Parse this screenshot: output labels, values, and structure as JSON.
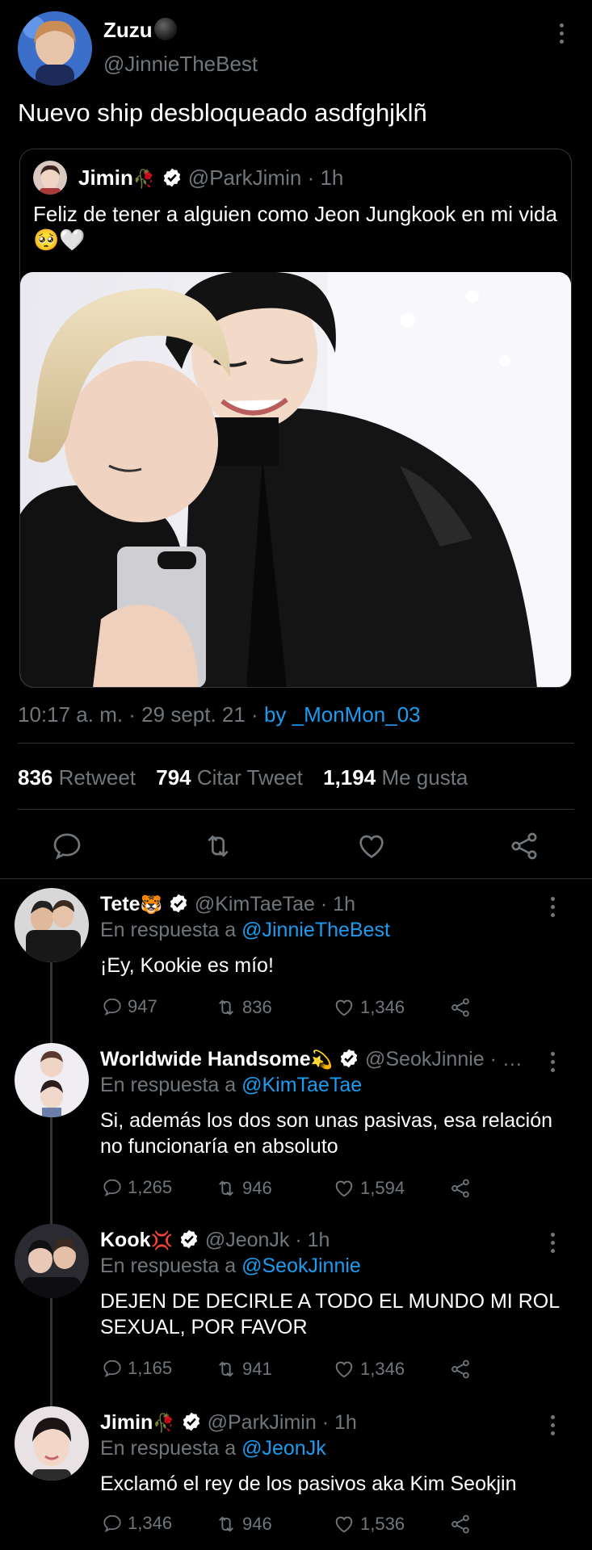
{
  "main_tweet": {
    "author_name": "Zuzu",
    "author_handle": "@JinnieTheBest",
    "text": "Nuevo ship desbloqueado asdfghjklñ",
    "quote": {
      "author_name": "Jimin",
      "author_emoji": "🥀",
      "handle": "@ParkJimin",
      "time": "1h",
      "text": "Feliz de tener a alguien como Jeon Jungkook en mi vida🥺🤍"
    },
    "timestamp": "10:17 a. m. · 29 sept. 21 · ",
    "source": "by _MonMon_03",
    "stats": {
      "retweets": "836",
      "retweets_label": "Retweet",
      "quotes": "794",
      "quotes_label": "Citar Tweet",
      "likes": "1,194",
      "likes_label": "Me gusta"
    }
  },
  "replies": [
    {
      "name": "Tete",
      "emoji": "🐯",
      "handle": "@KimTaeTae",
      "time": "1h",
      "reply_prefix": "En respuesta a ",
      "reply_to": "@JinnieTheBest",
      "text": "¡Ey, Kookie es mío!",
      "comments": "947",
      "retweets": "836",
      "likes": "1,346"
    },
    {
      "name": "Worldwide Handsome",
      "emoji": "💫",
      "handle": "@SeokJinnie",
      "time": "…",
      "reply_prefix": "En respuesta a ",
      "reply_to": "@KimTaeTae",
      "text": "Si, además los dos son unas pasivas, esa relación no funcionaría en absoluto",
      "comments": "1,265",
      "retweets": "946",
      "likes": "1,594"
    },
    {
      "name": "Kook",
      "emoji": "💢",
      "handle": "@JeonJk",
      "time": "1h",
      "reply_prefix": "En respuesta a ",
      "reply_to": "@SeokJinnie",
      "text": "DEJEN DE DECIRLE A TODO EL MUNDO MI ROL SEXUAL, POR FAVOR",
      "comments": "1,165",
      "retweets": "941",
      "likes": "1,346"
    },
    {
      "name": "Jimin",
      "emoji": "🥀",
      "handle": "@ParkJimin",
      "time": "1h",
      "reply_prefix": "En respuesta a ",
      "reply_to": "@JeonJk",
      "text": "Exclamó el rey de los pasivos aka Kim Seokjin",
      "comments": "1,346",
      "retweets": "946",
      "likes": "1,536"
    }
  ],
  "colors": {
    "background": "#000000",
    "text": "#e7e9ea",
    "secondary": "#71767b",
    "link": "#1d9bf0",
    "divider": "#2f3336"
  }
}
